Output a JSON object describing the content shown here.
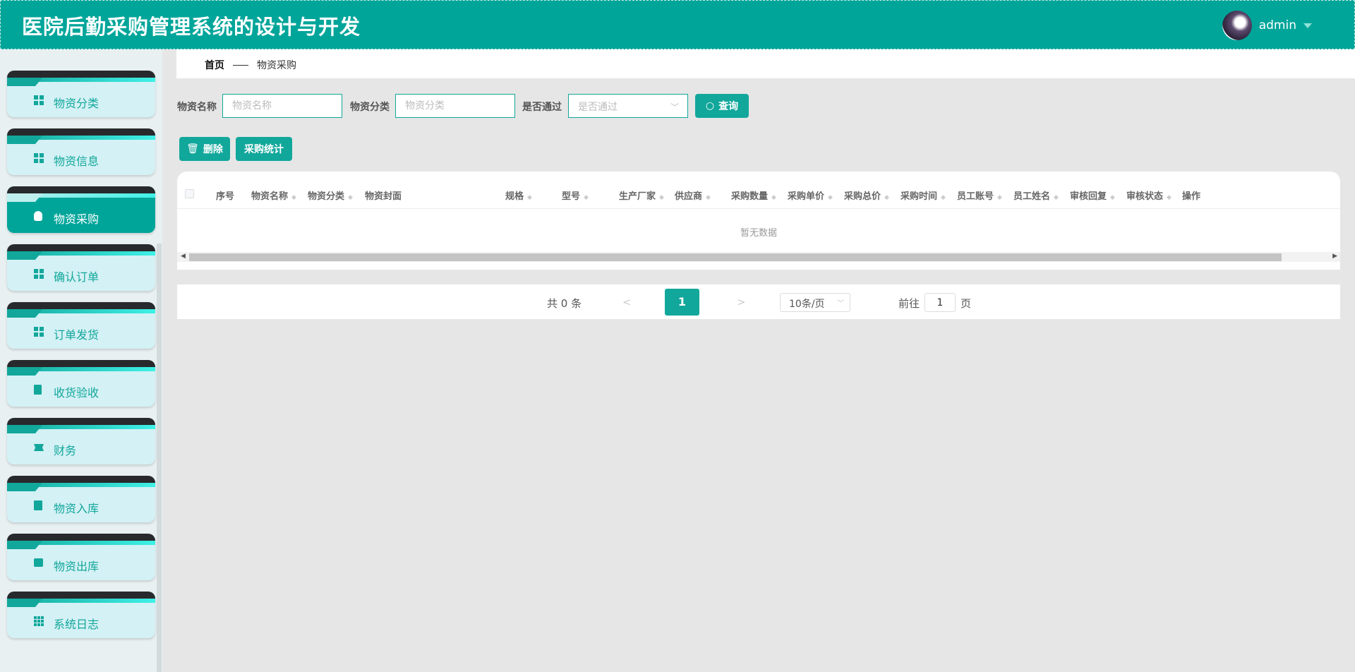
{
  "header": {
    "title": "医院后勤采购管理系统的设计与开发",
    "username": "admin"
  },
  "sidebar": {
    "items": [
      {
        "label": "物资分类",
        "icon": "grid-icon"
      },
      {
        "label": "物资信息",
        "icon": "grid-icon"
      },
      {
        "label": "物资采购",
        "icon": "bulb-icon",
        "active": true
      },
      {
        "label": "确认订单",
        "icon": "grid-icon"
      },
      {
        "label": "订单发货",
        "icon": "grid-icon"
      },
      {
        "label": "收货验收",
        "icon": "clipboard-icon"
      },
      {
        "label": "财务",
        "icon": "ticket-icon"
      },
      {
        "label": "物资入库",
        "icon": "clipboard-check-icon"
      },
      {
        "label": "物资出库",
        "icon": "box-icon"
      },
      {
        "label": "系统日志",
        "icon": "apps-icon"
      }
    ]
  },
  "breadcrumb": {
    "home": "首页",
    "current": "物资采购"
  },
  "filters": {
    "name": {
      "label": "物资名称",
      "placeholder": "物资名称"
    },
    "category": {
      "label": "物资分类",
      "placeholder": "物资分类"
    },
    "passed": {
      "label": "是否通过",
      "placeholder": "是否通过"
    },
    "search_label": "查询"
  },
  "actions": {
    "delete_label": "删除",
    "stats_label": "采购统计"
  },
  "table": {
    "columns": [
      "序号",
      "物资名称",
      "物资分类",
      "物资封面",
      "规格",
      "型号",
      "生产厂家",
      "供应商",
      "采购数量",
      "采购单价",
      "采购总价",
      "采购时间",
      "员工账号",
      "员工姓名",
      "审核回复",
      "审核状态",
      "操作"
    ],
    "sortable": [
      false,
      true,
      true,
      false,
      true,
      true,
      true,
      true,
      true,
      true,
      true,
      true,
      true,
      true,
      true,
      true,
      false
    ],
    "empty_text": "暂无数据"
  },
  "pagination": {
    "total_text": "共 0 条",
    "prev": "<",
    "current_page": "1",
    "next": ">",
    "page_size": "10条/页",
    "goto_label": "前往",
    "goto_value": "1",
    "page_suffix": "页"
  },
  "colors": {
    "accent": "#00a59a"
  }
}
